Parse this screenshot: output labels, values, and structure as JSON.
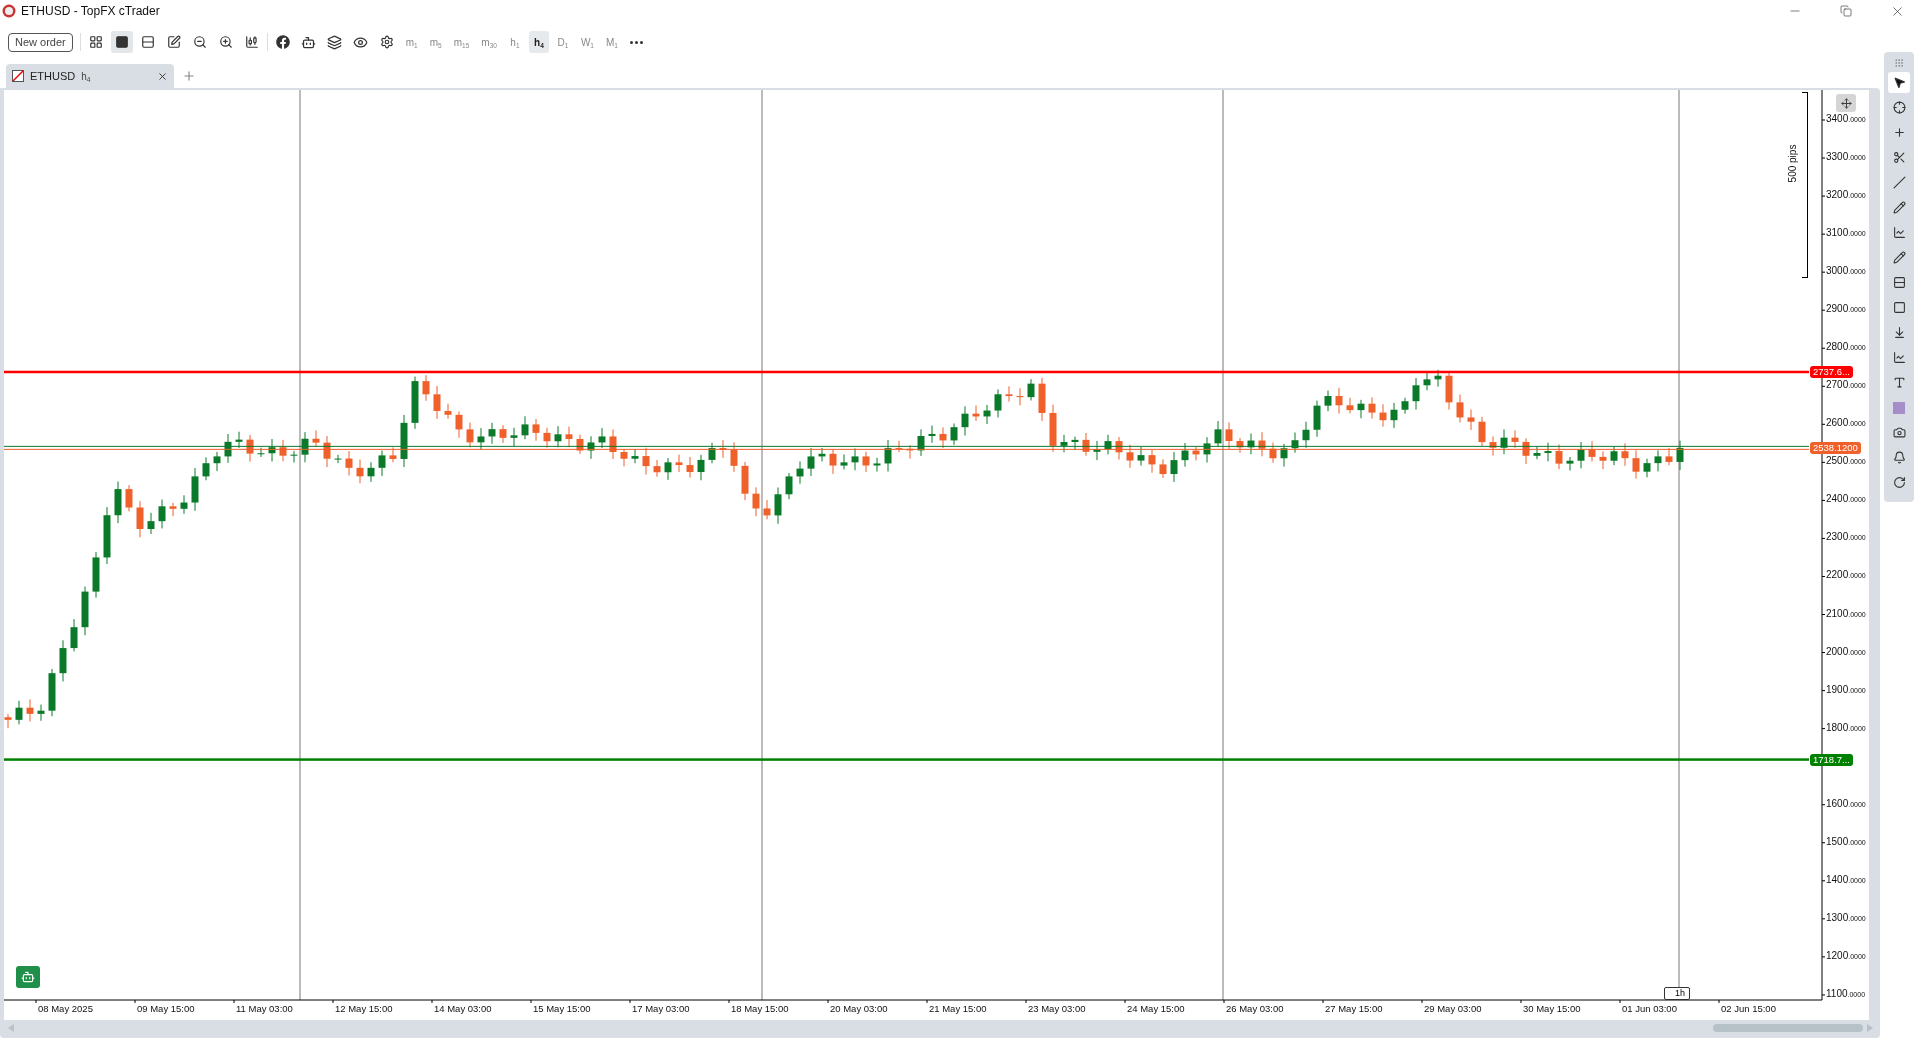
{
  "window": {
    "title": "ETHUSD - TopFX cTrader"
  },
  "toolbar": {
    "new_order": "New order",
    "timeframes": [
      {
        "label": "m$_{1}$",
        "selected": false
      },
      {
        "label": "m$_{5}$",
        "selected": false
      },
      {
        "label": "m$_{15}$",
        "selected": false
      },
      {
        "label": "m$_{30}$",
        "selected": false
      },
      {
        "label": "h$_{1}$",
        "selected": false
      },
      {
        "label": "h$_{4}$",
        "selected": true
      },
      {
        "label": "D$_{1}$",
        "selected": false
      },
      {
        "label": "W$_{1}$",
        "selected": false
      },
      {
        "label": "M$_{1}$",
        "selected": false
      }
    ]
  },
  "tabs": [
    {
      "symbol": "ETHUSD",
      "timeframe": "h$_{4}$",
      "selected": true
    }
  ],
  "chart": {
    "price_labels": [
      "3400$_{.0000}$",
      "3300$_{.0000}$",
      "3200$_{.0000}$",
      "3100$_{.0000}$",
      "3000$_{.0000}$",
      "2900$_{.0000}$",
      "2800$_{.0000}$",
      "2700$_{.0000}$",
      "2600$_{.0000}$",
      "2500$_{.0000}$",
      "2400$_{.0000}$",
      "2300$_{.0000}$",
      "2200$_{.0000}$",
      "2100$_{.0000}$",
      "2000$_{.0000}$",
      "1900$_{.0000}$",
      "1800$_{.0000}$",
      "1600$_{.0000}$",
      "1500$_{.0000}$",
      "1400$_{.0000}$",
      "1300$_{.0000}$",
      "1200$_{.0000}$",
      "1100$_{.0000}$"
    ],
    "date_labels": [
      "08 May 2025",
      "09 May 15:00",
      "11 May 03:00",
      "12 May 15:00",
      "14 May 03:00",
      "15 May 15:00",
      "17 May 03:00",
      "18 May 15:00",
      "20 May 03:00",
      "21 May 15:00",
      "23 May 03:00",
      "24 May 15:00",
      "26 May 03:00",
      "27 May 15:00",
      "29 May 03:00",
      "30 May 15:00",
      "01 Jun 03:00",
      "02 Jun 15:00"
    ],
    "lines": [
      {
        "kind": "horizontal",
        "label": "2737.6...",
        "color": "#ff0000"
      },
      {
        "kind": "current",
        "label": "2538.1200",
        "color": "#f0602a"
      },
      {
        "kind": "horizontal",
        "label": "1718.7...",
        "color": "#008000"
      }
    ],
    "ruler": "500 pips",
    "period_marker": "1h"
  }
}
